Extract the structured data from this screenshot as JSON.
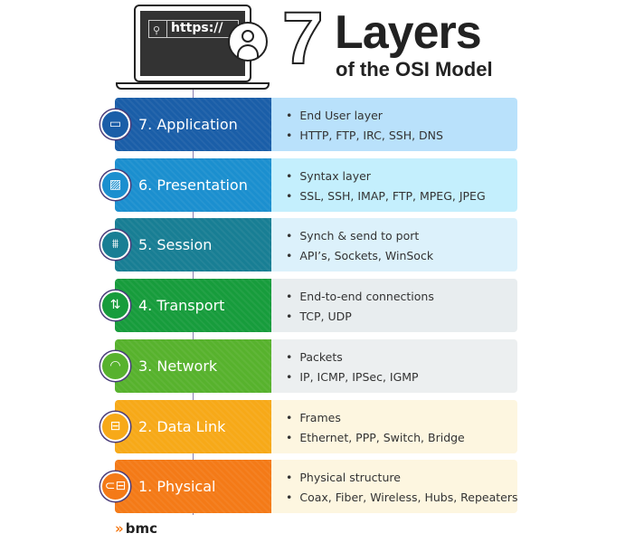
{
  "header": {
    "url_text": "https://",
    "big_number": "7",
    "title": "Layers",
    "subtitle": "of the OSI Model"
  },
  "layers": [
    {
      "name": "7. Application",
      "icon": "window-icon",
      "glyph": "▭",
      "color": "#1a5ea8",
      "light": "#b9e1fb",
      "bullets": [
        "End User layer",
        "HTTP, FTP, IRC, SSH, DNS"
      ]
    },
    {
      "name": "6. Presentation",
      "icon": "image-icon",
      "glyph": "▨",
      "color": "#1b8fcf",
      "light": "#c4effd",
      "bullets": [
        "Syntax layer",
        "SSL, SSH, IMAP, FTP, MPEG, JPEG"
      ]
    },
    {
      "name": "5. Session",
      "icon": "bridge-icon",
      "glyph": "⩩",
      "color": "#187e94",
      "light": "#dcf1fb",
      "bullets": [
        "Synch & send to port",
        "API’s, Sockets, WinSock"
      ]
    },
    {
      "name": "4. Transport",
      "icon": "arrows-up-down-icon",
      "glyph": "⇅",
      "color": "#179c3c",
      "light": "#e8edef",
      "bullets": [
        "End-to-end connections",
        "TCP, UDP"
      ]
    },
    {
      "name": "3. Network",
      "icon": "wifi-icon",
      "glyph": "◠",
      "color": "#57b22d",
      "light": "#eceff0",
      "bullets": [
        "Packets",
        "IP, ICMP, IPSec, IGMP"
      ]
    },
    {
      "name": "2. Data Link",
      "icon": "router-icon",
      "glyph": "⊟",
      "color": "#f7a918",
      "light": "#fdf6e0",
      "bullets": [
        "Frames",
        "Ethernet, PPP, Switch, Bridge"
      ]
    },
    {
      "name": "1. Physical",
      "icon": "cable-icon",
      "glyph": "⊂⊟",
      "color": "#f47a17",
      "light": "#fdf6e0",
      "bullets": [
        "Physical structure",
        "Coax, Fiber, Wireless, Hubs, Repeaters"
      ]
    }
  ],
  "footer": {
    "logo": "bmc"
  }
}
